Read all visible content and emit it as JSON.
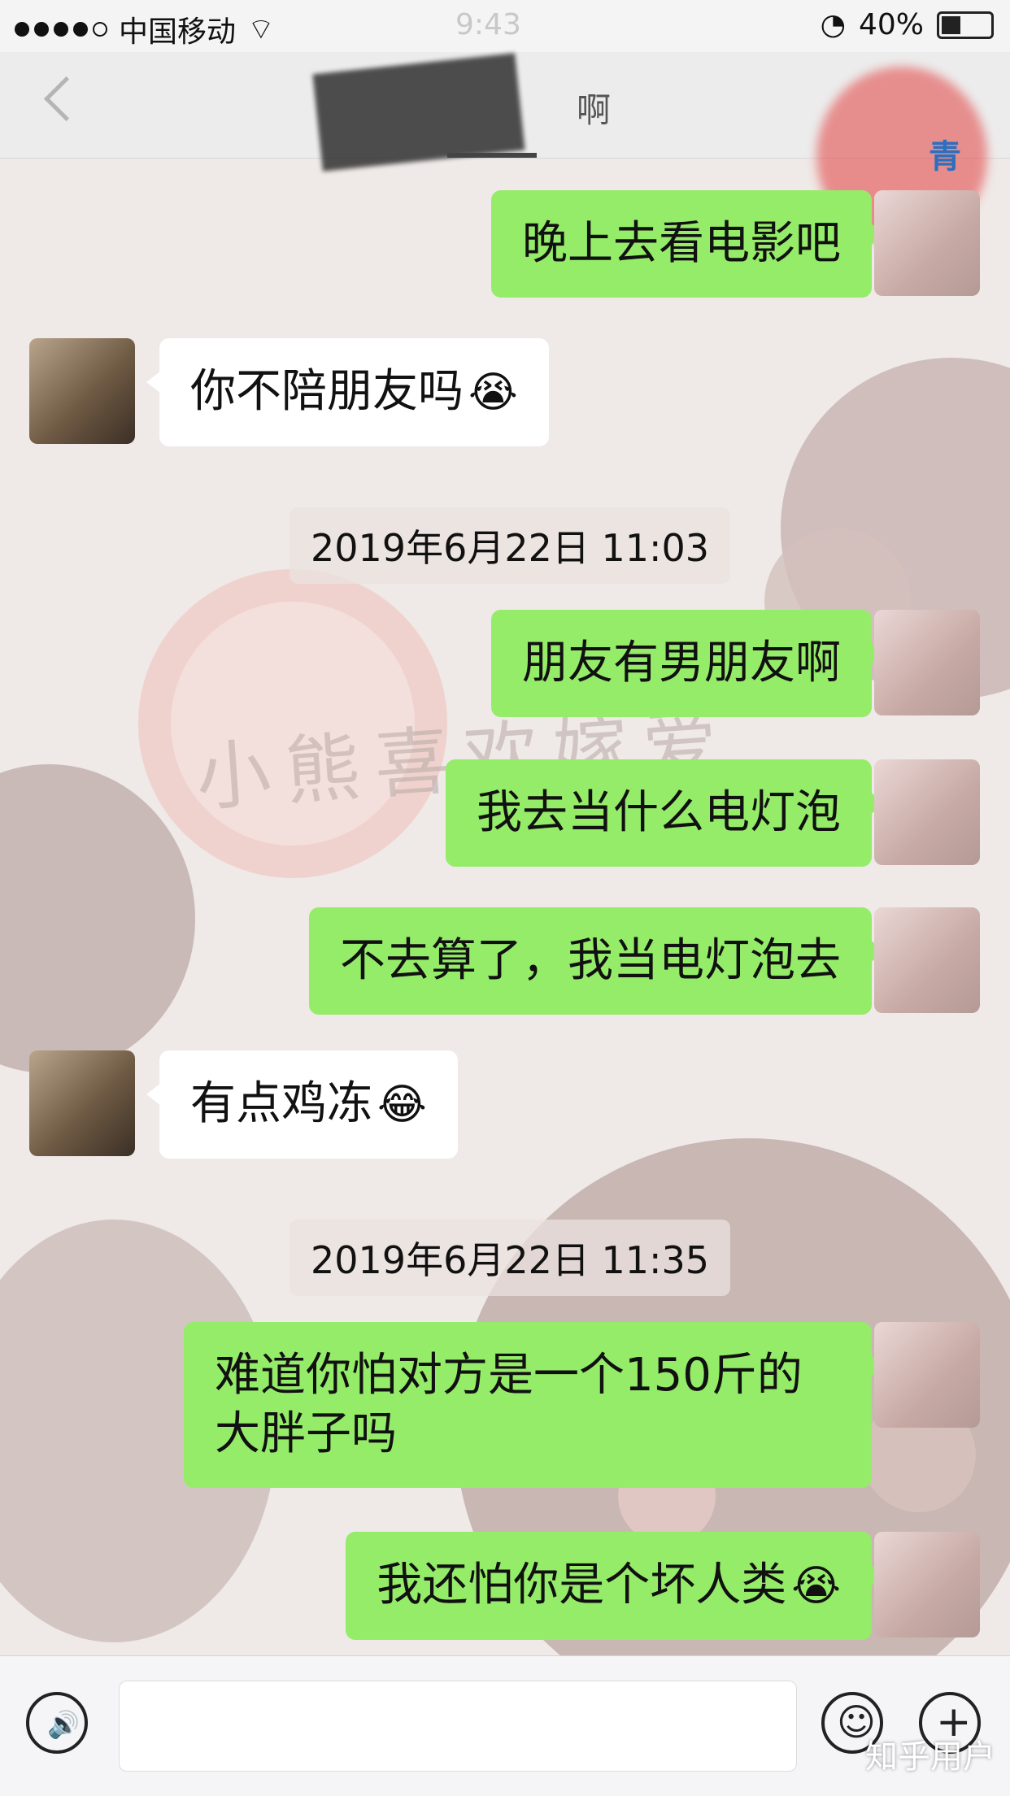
{
  "status_bar": {
    "carrier": "中国移动",
    "time": "9:43",
    "battery": "40%",
    "battery_level": 0.4
  },
  "nav": {
    "title": "啊",
    "corner_badge": "青"
  },
  "messages": [
    {
      "sender": "me",
      "text": "晚上去看电影吧"
    },
    {
      "sender": "other",
      "text": "你不陪朋友吗",
      "emoji": "😭"
    },
    {
      "type": "timestamp",
      "text": "2019年6月22日 11:03"
    },
    {
      "sender": "me",
      "text": "朋友有男朋友啊"
    },
    {
      "sender": "me",
      "text": "我去当什么电灯泡"
    },
    {
      "sender": "me",
      "text": "不去算了，我当电灯泡去"
    },
    {
      "sender": "other",
      "text": "有点鸡冻",
      "emoji": "😂"
    },
    {
      "type": "timestamp",
      "text": "2019年6月22日 11:35"
    },
    {
      "sender": "me",
      "text": "难道你怕对方是一个150斤的大胖子吗"
    },
    {
      "sender": "me",
      "text": "我还怕你是个坏人类",
      "emoji": "😭"
    }
  ],
  "input_bar": {
    "voice_icon": "voice-icon",
    "emoji_icon": "emoji-icon",
    "plus_icon": "plus-icon",
    "voice_glyph": "🔊",
    "emoji_glyph": "☺",
    "plus_glyph": "+"
  },
  "watermark": "知乎用户",
  "wallpaper_text": "小熊喜欢嫁爱",
  "colors": {
    "my_bubble": "#95ec69",
    "other_bubble": "#ffffff",
    "timestamp_bg": "#ebe1df"
  }
}
